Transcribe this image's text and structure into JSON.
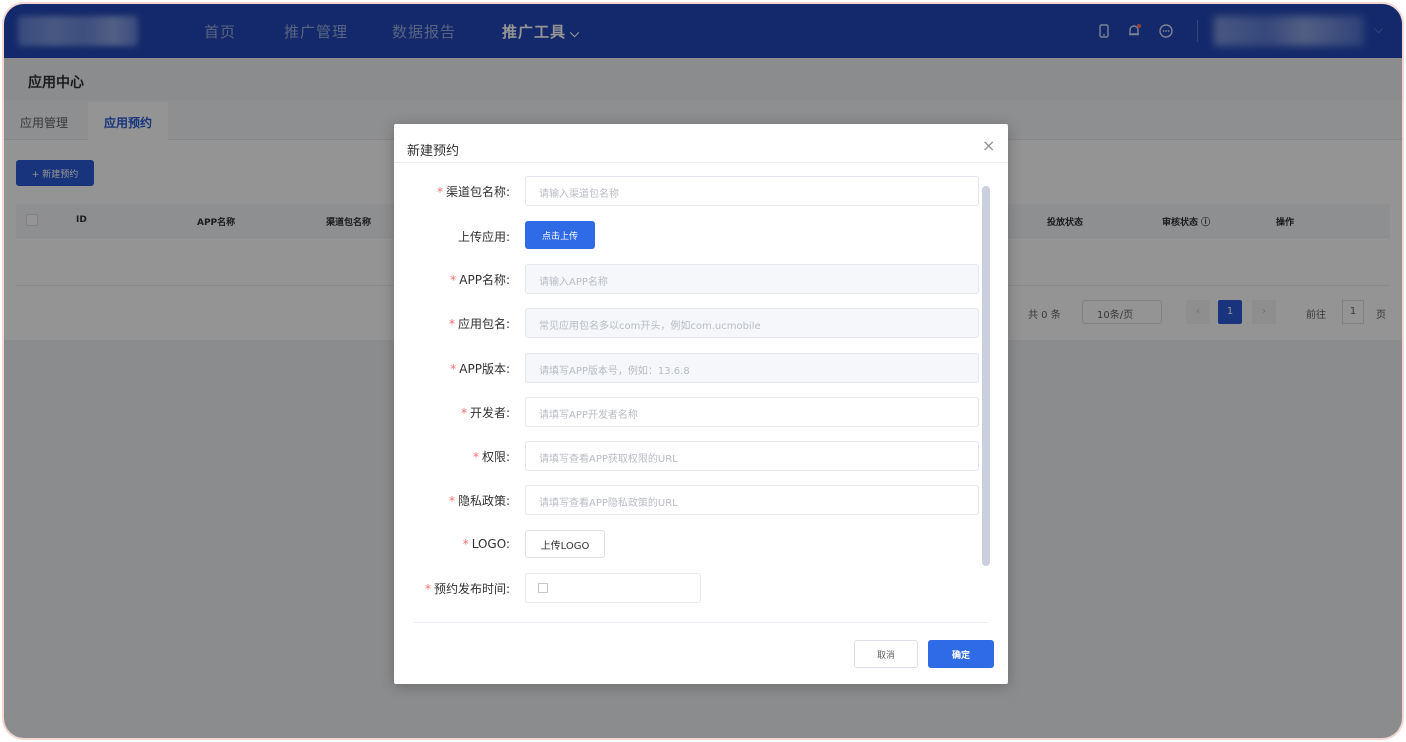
{
  "nav": {
    "items": [
      {
        "label": "首页"
      },
      {
        "label": "推广管理"
      },
      {
        "label": "数据报告"
      },
      {
        "label": "推广工具"
      }
    ],
    "active_chevron": "⌵"
  },
  "page": {
    "title": "应用中心",
    "tabs": [
      {
        "label": "应用管理",
        "active": false
      },
      {
        "label": "应用预约",
        "active": true
      }
    ],
    "new_button": "+ 新建预约"
  },
  "table": {
    "columns": [
      "ID",
      "APP名称",
      "渠道包名称",
      "投放状态",
      "审核状态 ⓘ",
      "操作"
    ]
  },
  "pagination": {
    "total_text": "共 0 条",
    "page_size": "10条/页",
    "prev": "‹",
    "current_page": "1",
    "next": "›",
    "goto_label": "前往",
    "goto_value": "1",
    "goto_unit": "页"
  },
  "dialog": {
    "title": "新建预约",
    "close": "×",
    "fields": [
      {
        "label": "渠道包名称:",
        "required": true,
        "placeholder": "请输入渠道包名称"
      },
      {
        "label": "上传应用:",
        "required": false,
        "button": "点击上传"
      },
      {
        "label": "APP名称:",
        "required": true,
        "placeholder": "请输入APP名称"
      },
      {
        "label": "应用包名:",
        "required": true,
        "placeholder": "常见应用包名多以com开头，例如com.ucmobile"
      },
      {
        "label": "APP版本:",
        "required": true,
        "placeholder": "请填写APP版本号，例如：13.6.8"
      },
      {
        "label": "开发者:",
        "required": true,
        "placeholder": "请填写APP开发者名称"
      },
      {
        "label": "权限:",
        "required": true,
        "placeholder": "请填写查看APP获取权限的URL"
      },
      {
        "label": "隐私政策:",
        "required": true,
        "placeholder": "请填写查看APP隐私政策的URL"
      },
      {
        "label": "LOGO:",
        "required": true,
        "button": "上传LOGO"
      },
      {
        "label": "预约发布时间:",
        "required": true
      }
    ],
    "required_mark": "*",
    "cancel": "取消",
    "confirm": "确定"
  },
  "colors": {
    "topbar": "#2448b8",
    "primary": "#2f6be6",
    "required": "#f56c6c"
  },
  "icons": [
    "phone-icon",
    "bell-icon",
    "message-icon",
    "close-icon",
    "calendar-icon"
  ]
}
